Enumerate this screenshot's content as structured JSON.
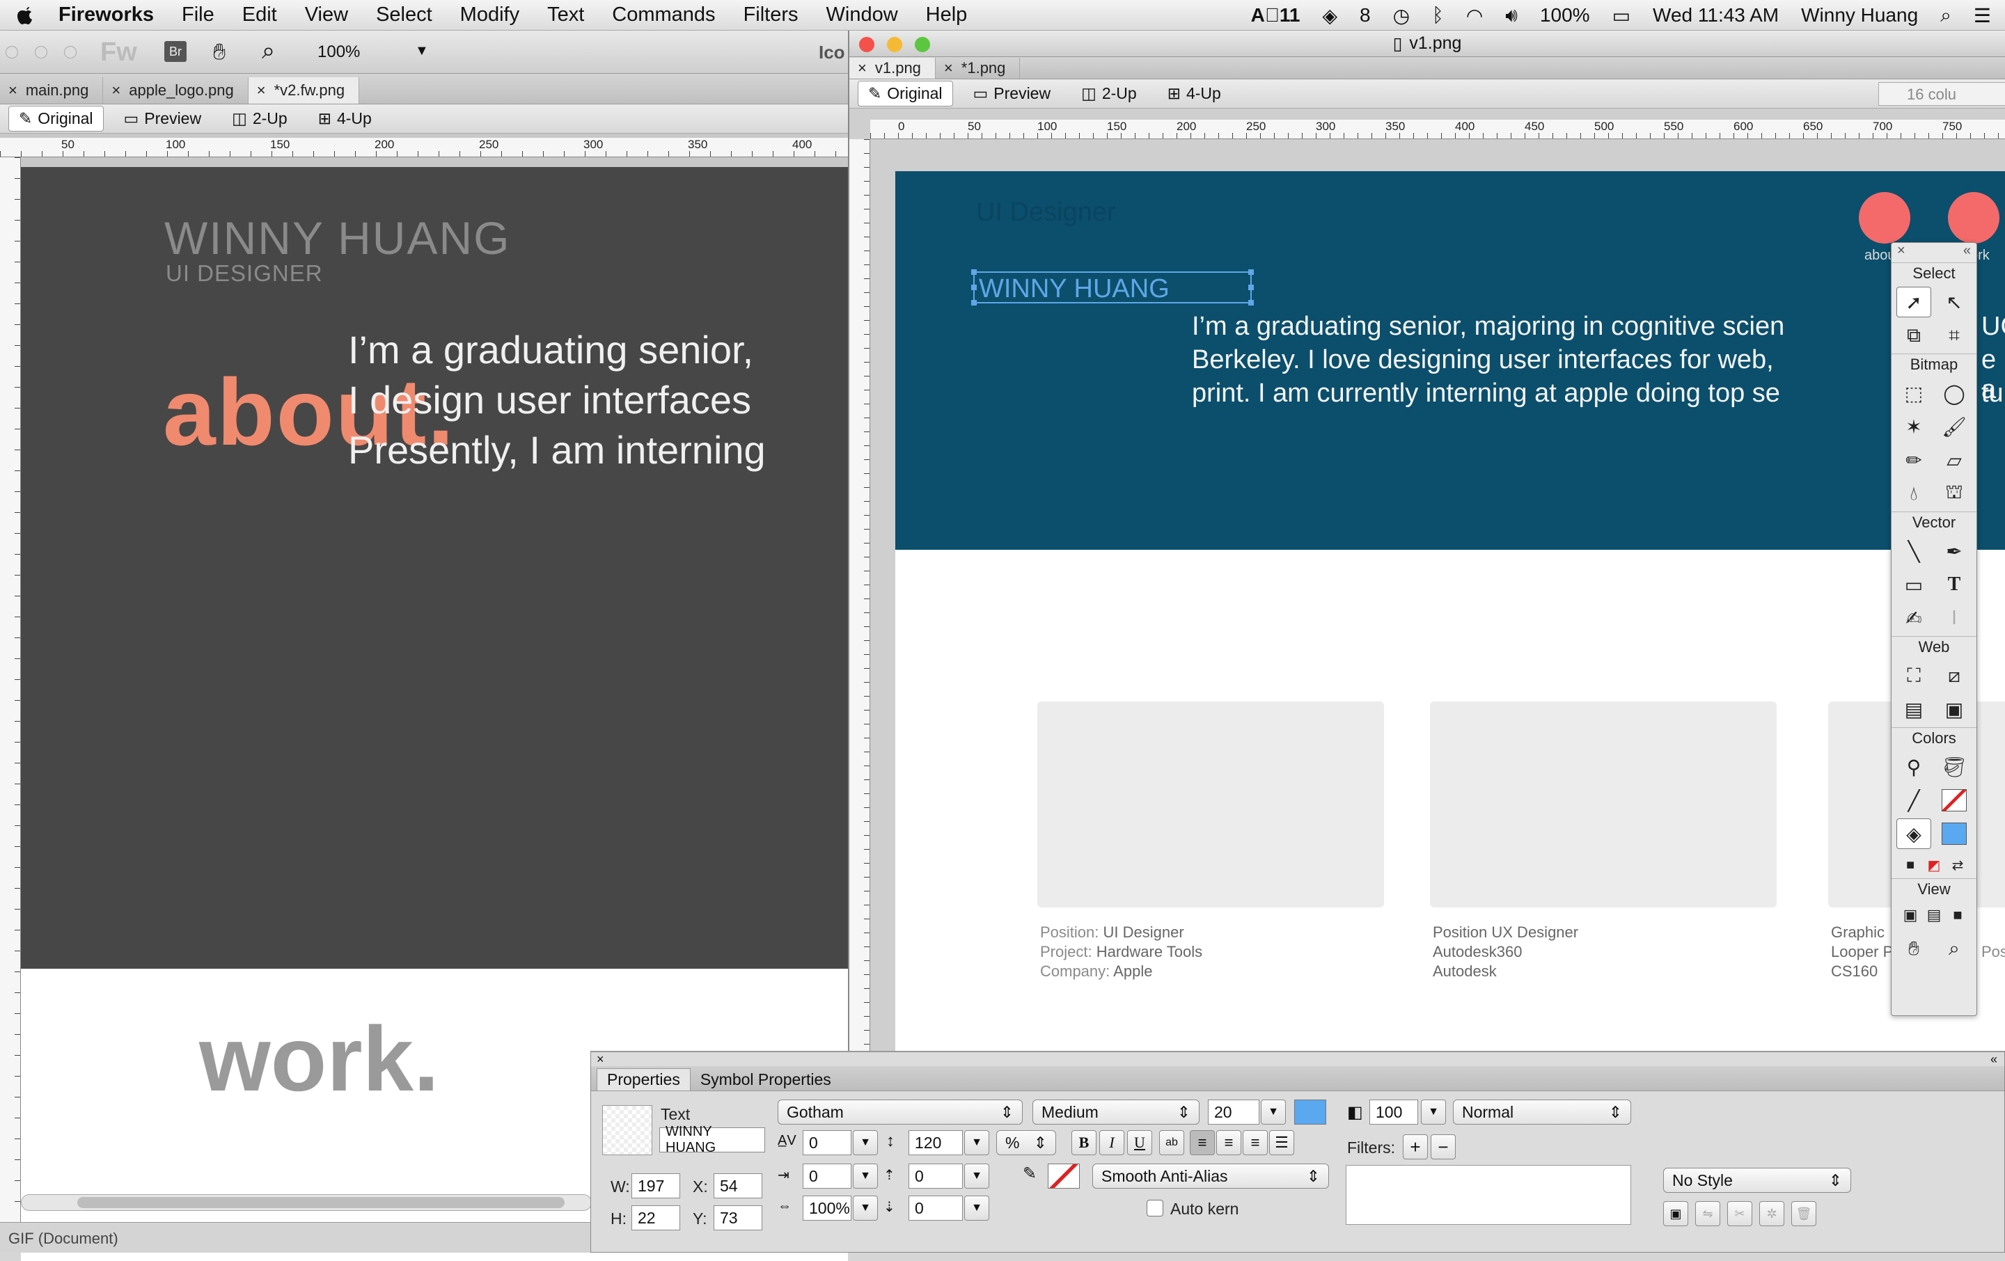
{
  "menubar": {
    "app": "Fireworks",
    "items": [
      "File",
      "Edit",
      "View",
      "Select",
      "Modify",
      "Text",
      "Commands",
      "Filters",
      "Window",
      "Help"
    ],
    "status": {
      "font_badge": "11",
      "battery": "100%",
      "clock": "Wed 11:43 AM",
      "user": "Winny Huang"
    }
  },
  "app_toolbar": {
    "fw_logo": "Fw",
    "br_badge": "Br",
    "zoom": "100%",
    "clipped_label": "Ico"
  },
  "left_window": {
    "tabs": [
      "main.png",
      "apple_logo.png",
      "*v2.fw.png"
    ],
    "modes": [
      "Original",
      "Preview",
      "2-Up",
      "4-Up"
    ],
    "ruler_marks": [
      "50",
      "100",
      "150",
      "200",
      "250",
      "300",
      "350",
      "400"
    ],
    "canvas": {
      "name": "WINNY HUANG",
      "role": "UI DESIGNER",
      "about": "about.",
      "bio": [
        "I’m a graduating senior,",
        "I design user interfaces",
        "Presently, I am interning"
      ],
      "work": "work."
    },
    "status": "GIF (Document)"
  },
  "right_window": {
    "title": "v1.png",
    "tabs": [
      "v1.png",
      "*1.png"
    ],
    "modes": [
      "Original",
      "Preview",
      "2-Up",
      "4-Up"
    ],
    "clipped_panel_label": "16 colu",
    "ruler_marks": [
      "0",
      "50",
      "100",
      "150",
      "200",
      "250",
      "300",
      "350",
      "400",
      "450",
      "500",
      "550",
      "600",
      "650",
      "700",
      "750"
    ],
    "canvas": {
      "ghost_title": "UI Designer",
      "name": "WINNY HUANG",
      "nav": [
        "abou",
        "ork"
      ],
      "bio": [
        "I’m a graduating senior, majoring in cognitive scien",
        "Berkeley. I love designing user interfaces for web,",
        "print. I am currently interning at apple doing top se"
      ],
      "bio_clipped_tail": [
        "UC",
        "e a",
        "tu"
      ],
      "cards": [
        {
          "lines": [
            [
              "Position: ",
              "UI Designer"
            ],
            [
              "Project: ",
              "Hardware Tools"
            ],
            [
              "Company: ",
              "Apple"
            ]
          ]
        },
        {
          "lines": [
            [
              "",
              "Position UX Designer"
            ],
            [
              "",
              "Autodesk360"
            ],
            [
              "",
              "Autodesk"
            ]
          ]
        },
        {
          "lines": [
            [
              "",
              "Graphic"
            ],
            [
              "",
              "Looper P"
            ],
            [
              "",
              "CS160"
            ]
          ]
        }
      ],
      "card3_extra": "Pos"
    }
  },
  "tools_panel": {
    "sections": [
      "Select",
      "Bitmap",
      "Vector",
      "Web",
      "Colors",
      "View"
    ]
  },
  "properties_panel": {
    "tabs": [
      "Properties",
      "Symbol Properties"
    ],
    "object_type": "Text",
    "object_name": "WINNY HUANG",
    "font_family": "Gotham",
    "font_style": "Medium",
    "font_size": "20",
    "kerning": "0",
    "leading": "120",
    "leading_unit": "%",
    "indent": "0",
    "space_before": "0",
    "space_after": "0",
    "horiz_scale": "100%",
    "baseline_shift": "0",
    "anti_alias": "Smooth Anti-Alias",
    "auto_kern": "Auto kern",
    "opacity": "100",
    "blend_mode": "Normal",
    "filters_label": "Filters:",
    "style": "No Style",
    "w": "197",
    "h": "22",
    "x": "54",
    "y": "73",
    "w_label": "W:",
    "h_label": "H:",
    "x_label": "X:",
    "y_label": "Y:",
    "bold": "B",
    "italic": "I",
    "underline": "U"
  },
  "colors": {
    "accent_orange": "#f08a6e",
    "dark_canvas": "#474747",
    "teal_header": "#0b4f6c",
    "selection_blue": "#5fa7e8",
    "red_circle": "#f46a6a",
    "fill_swatch": "#5aa8f0"
  }
}
